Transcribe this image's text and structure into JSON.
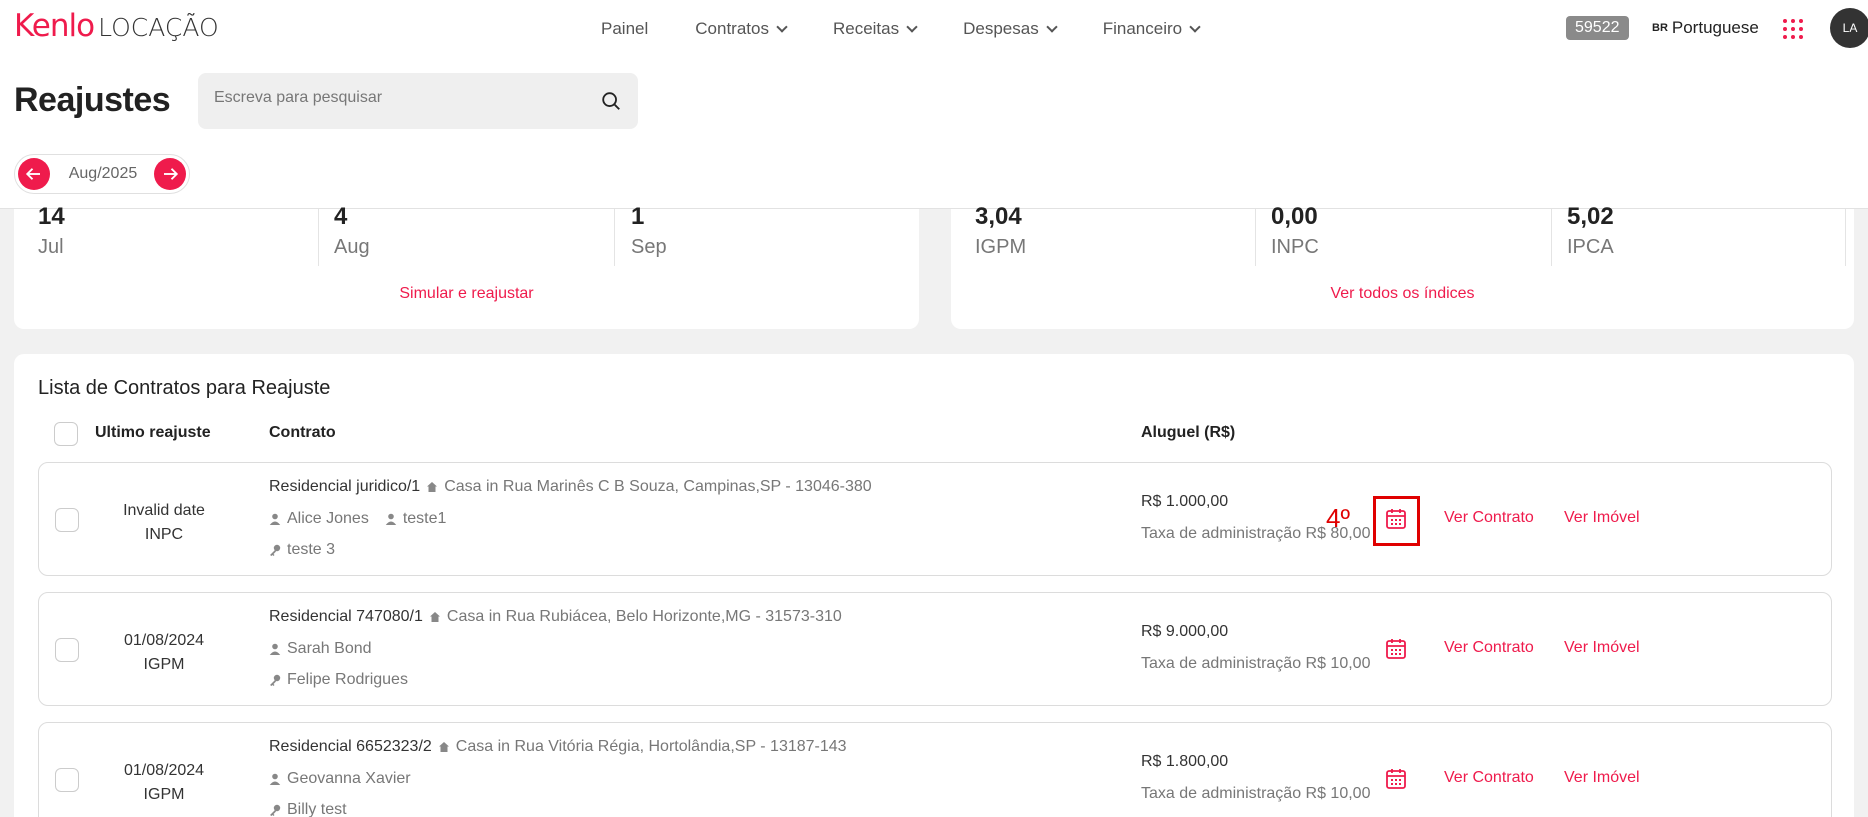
{
  "nav": {
    "logo_main": "Kenlo",
    "logo_sub": "LOCAÇÃO",
    "items": [
      "Painel",
      "Contratos",
      "Receitas",
      "Despesas",
      "Financeiro"
    ],
    "badge": "59522",
    "lang_flag": "BR",
    "lang_label": "Portuguese",
    "avatar_initials": "LA"
  },
  "header": {
    "title": "Reajustes",
    "search_placeholder": "Escreva para pesquisar",
    "month": "Aug/2025"
  },
  "summary_left": {
    "stats": [
      {
        "value": "14",
        "label": "Jul"
      },
      {
        "value": "4",
        "label": "Aug"
      },
      {
        "value": "1",
        "label": "Sep"
      }
    ],
    "link": "Simular e reajustar"
  },
  "summary_right": {
    "stats": [
      {
        "value": "3,04",
        "label": "IGPM"
      },
      {
        "value": "0,00",
        "label": "INPC"
      },
      {
        "value": "5,02",
        "label": "IPCA"
      }
    ],
    "link": "Ver todos os índices"
  },
  "list": {
    "title": "Lista de Contratos para Reajuste",
    "headers": {
      "last": "Ultimo reajuste",
      "contract": "Contrato",
      "rent": "Aluguel (R$)"
    },
    "annotation": "4º",
    "view_contract": "Ver Contrato",
    "view_property": "Ver Imóvel",
    "rows": [
      {
        "date": "Invalid date",
        "index": "INPC",
        "contract": "Residencial juridico/1",
        "address": "Casa in Rua Marinês C B Souza, Campinas,SP - 13046-380",
        "tenant": "Alice Jones",
        "owner": "teste1",
        "guarantor": "teste 3",
        "rent": "R$ 1.000,00",
        "fee": "Taxa de administração R$ 80,00"
      },
      {
        "date": "01/08/2024",
        "index": "IGPM",
        "contract": "Residencial 747080/1",
        "address": "Casa in Rua Rubiácea, Belo Horizonte,MG - 31573-310",
        "tenant": "Sarah Bond",
        "owner": "",
        "guarantor": "Felipe Rodrigues",
        "rent": "R$ 9.000,00",
        "fee": "Taxa de administração R$ 10,00"
      },
      {
        "date": "01/08/2024",
        "index": "IGPM",
        "contract": "Residencial 6652323/2",
        "address": "Casa in Rua Vitória Régia, Hortolândia,SP - 13187-143",
        "tenant": "Geovanna Xavier",
        "owner": "",
        "guarantor": "Billy test",
        "rent": "R$ 1.800,00",
        "fee": "Taxa de administração R$ 10,00"
      }
    ]
  }
}
